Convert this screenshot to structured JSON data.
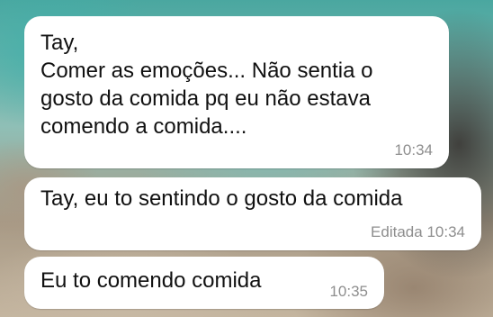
{
  "messages": [
    {
      "text": "Tay,\nComer as emoções... Não sentia o\ngosto da comida pq eu não estava\ncomendo a comida....",
      "time": "10:34",
      "edited_label": ""
    },
    {
      "text": "Tay, eu to sentindo o gosto da comida",
      "time": "10:34",
      "edited_label": "Editada"
    },
    {
      "text": "Eu to comendo comida",
      "time": "10:35",
      "edited_label": ""
    }
  ],
  "colors": {
    "bubble_background": "#ffffff",
    "text": "#111111",
    "meta_text": "#8e8e8e"
  }
}
